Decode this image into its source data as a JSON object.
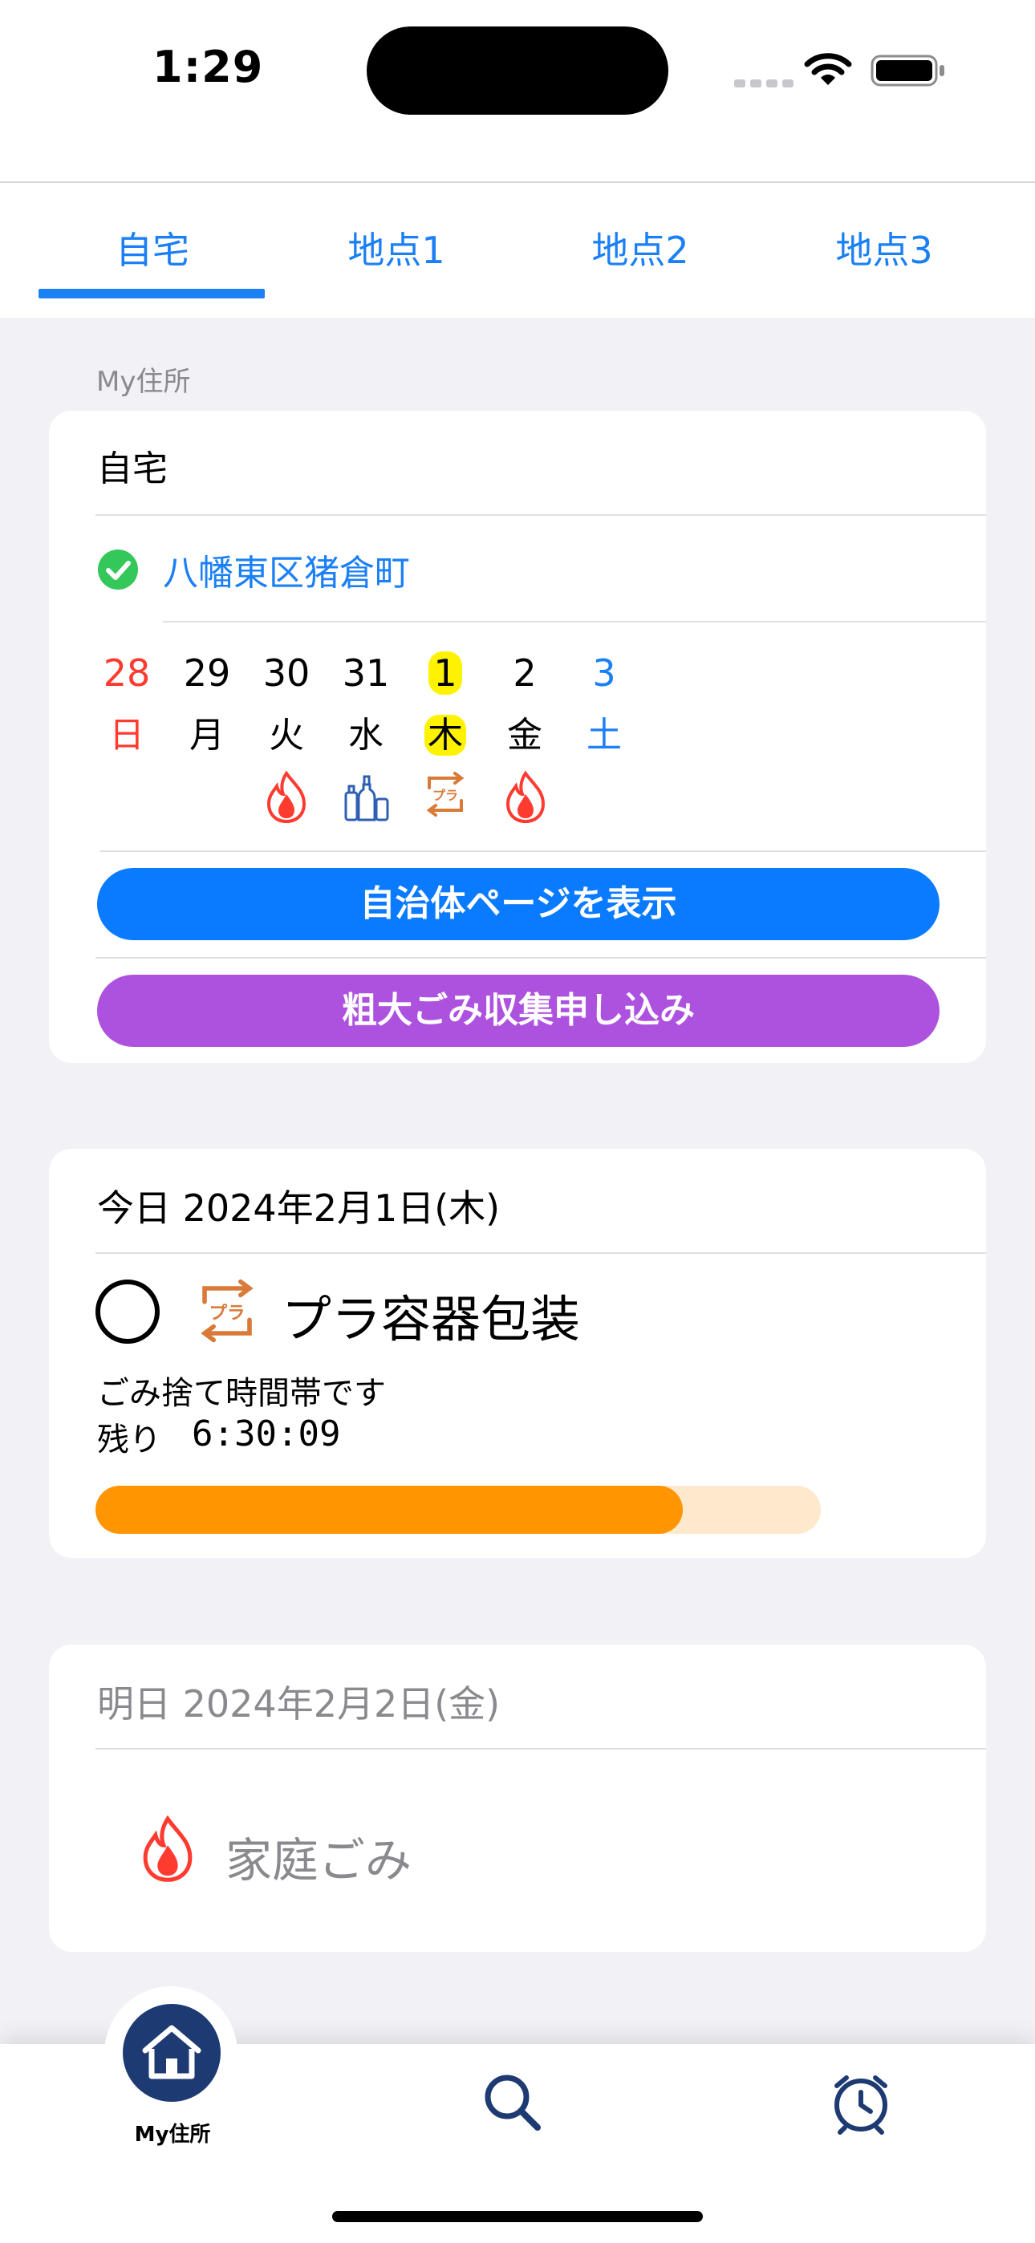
{
  "status": {
    "time": "1:29"
  },
  "tabs": [
    "自宅",
    "地点1",
    "地点2",
    "地点3"
  ],
  "section_title": "My住所",
  "home_card": {
    "name": "自宅",
    "address": "八幡東区猪倉町",
    "days": [
      {
        "num": "28",
        "wk": "日",
        "color": "#ff3b30"
      },
      {
        "num": "29",
        "wk": "月",
        "color": "#000000"
      },
      {
        "num": "30",
        "wk": "火",
        "color": "#000000"
      },
      {
        "num": "31",
        "wk": "水",
        "color": "#000000"
      },
      {
        "num": "1",
        "wk": "木",
        "color": "#000000"
      },
      {
        "num": "2",
        "wk": "金",
        "color": "#000000"
      },
      {
        "num": "3",
        "wk": "土",
        "color": "#1b80f5"
      }
    ],
    "btn_city": "自治体ページを表示",
    "btn_bulky": "粗大ごみ収集申し込み"
  },
  "today_card": {
    "header": "今日  2024年2月1日(木)",
    "trash_type": "プラ容器包装",
    "message": "ごみ捨て時間帯です",
    "remain_label": "残り",
    "remain_time": "6:30:09",
    "progress": 0.81
  },
  "tomorrow_card": {
    "header": "明日  2024年2月2日(金)",
    "trash_type": "家庭ごみ"
  },
  "bottom_nav": {
    "home_label": "My住所"
  },
  "colors": {
    "accent": "#1b80f5",
    "city_button": "#0a7bff",
    "bulky_button": "#ad52de",
    "progress": "#ff9500",
    "today_highlight": "#fff200",
    "nav_home": "#1e3a73"
  }
}
